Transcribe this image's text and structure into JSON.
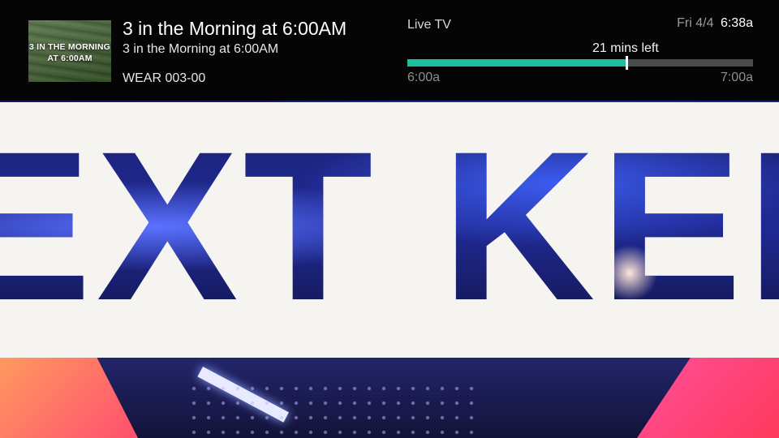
{
  "program": {
    "thumbnail_text": "3 IN THE MORNING AT 6:00AM",
    "title": "3 in the Morning at 6:00AM",
    "subtitle": "3 in the Morning at 6:00AM",
    "channel": "WEAR 003-00"
  },
  "status": {
    "source": "Live TV",
    "date": "Fri 4/4",
    "time": "6:38a"
  },
  "progress": {
    "remaining_label": "21 mins left",
    "start_time": "6:00a",
    "end_time": "7:00a",
    "elapsed_fraction": 0.633,
    "fill_color": "#1fc0a0"
  },
  "video": {
    "overlay_text": "EXT KEL"
  },
  "icons": {
    "thumbnail": "program-thumbnail-image"
  }
}
